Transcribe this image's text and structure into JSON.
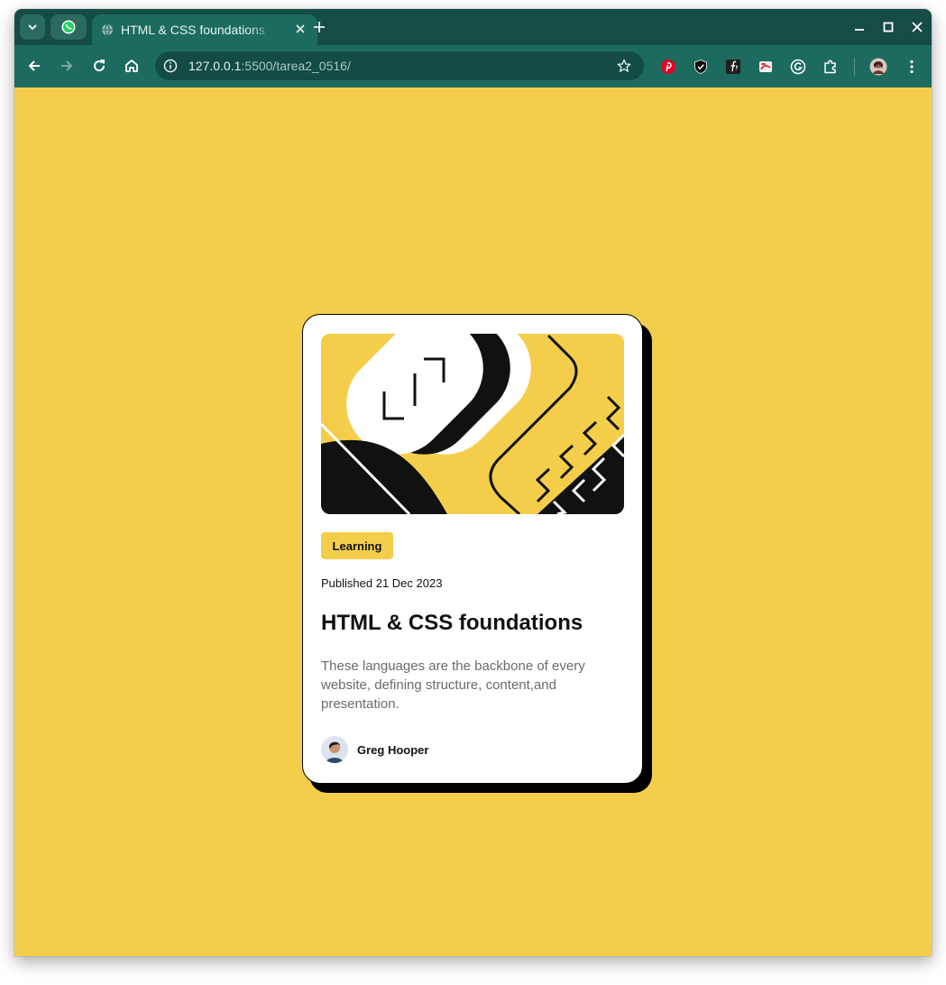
{
  "browser": {
    "tab_title": "HTML & CSS foundations",
    "url_host": "127.0.0.1",
    "url_rest": ":5500/tarea2_0516/"
  },
  "card": {
    "category": "Learning",
    "published": "Published 21 Dec 2023",
    "title": "HTML & CSS foundations",
    "description": "These languages are the backbone of every website, defining structure, content,and presentation.",
    "author": "Greg Hooper"
  },
  "colors": {
    "accent": "#f4ce4b",
    "titlebar": "#154c44",
    "toolbar": "#1c6b5e"
  }
}
